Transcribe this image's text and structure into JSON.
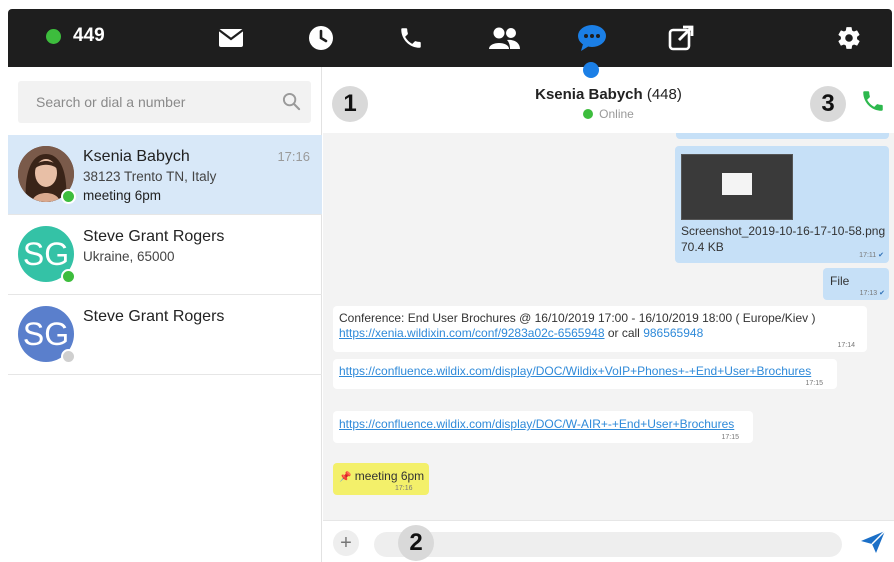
{
  "topbar": {
    "status_count": "449",
    "status_color": "#3dbd3d",
    "nav": [
      {
        "name": "mail-icon"
      },
      {
        "name": "clock-icon"
      },
      {
        "name": "phone-icon"
      },
      {
        "name": "contacts-icon"
      },
      {
        "name": "chat-icon",
        "active": true
      },
      {
        "name": "external-link-icon"
      },
      {
        "name": "gear-icon"
      }
    ],
    "active_color": "#1b7fe6"
  },
  "search": {
    "placeholder": "Search or dial a number"
  },
  "contacts": [
    {
      "name": "Ksenia Babych",
      "line2": "38123 Trento TN, Italy",
      "line3": "meeting 6pm",
      "time": "17:16",
      "presence": "online",
      "active": true
    },
    {
      "name": "Steve Grant Rogers",
      "initials": "SG",
      "line2": "Ukraine, 65000",
      "presence": "online",
      "avatar_color": "#34c2a6"
    },
    {
      "name": "Steve Grant Rogers",
      "initials": "SG",
      "presence": "offline",
      "avatar_color": "#5a7fcc"
    }
  ],
  "chat": {
    "contact_name": "Ksenia Babych",
    "contact_ext": "(448)",
    "status": "Online",
    "badges": [
      "1",
      "2",
      "3"
    ],
    "messages": {
      "file_name": "Screenshot_2019-10-16-17-10-58.png",
      "file_size": "70.4 KB",
      "file_time": "17:11",
      "file_label": "File",
      "file_label_time": "17:13",
      "conf_text": "Conference: End User Brochures @ 16/10/2019 17:00 - 16/10/2019 18:00 ( Europe/Kiev )",
      "conf_link": "https://xenia.wildixin.com/conf/9283a02c-6565948",
      "conf_or": " or call ",
      "conf_phone": "986565948",
      "conf_time": "17:14",
      "link1": "https://confluence.wildix.com/display/DOC/Wildix+VoIP+Phones+-+End+User+Brochures",
      "link1_time": "17:15",
      "link2": "https://confluence.wildix.com/display/DOC/W-AIR+-+End+User+Brochures",
      "link2_time": "17:15",
      "pinned_text": "meeting 6pm",
      "pinned_time": "17:16"
    }
  },
  "colors": {
    "outgoing_bubble": "#c6e0f7",
    "pinned_highlight": "#f3f06a",
    "call_green": "#2db84d",
    "send_blue": "#1b6fc7"
  }
}
